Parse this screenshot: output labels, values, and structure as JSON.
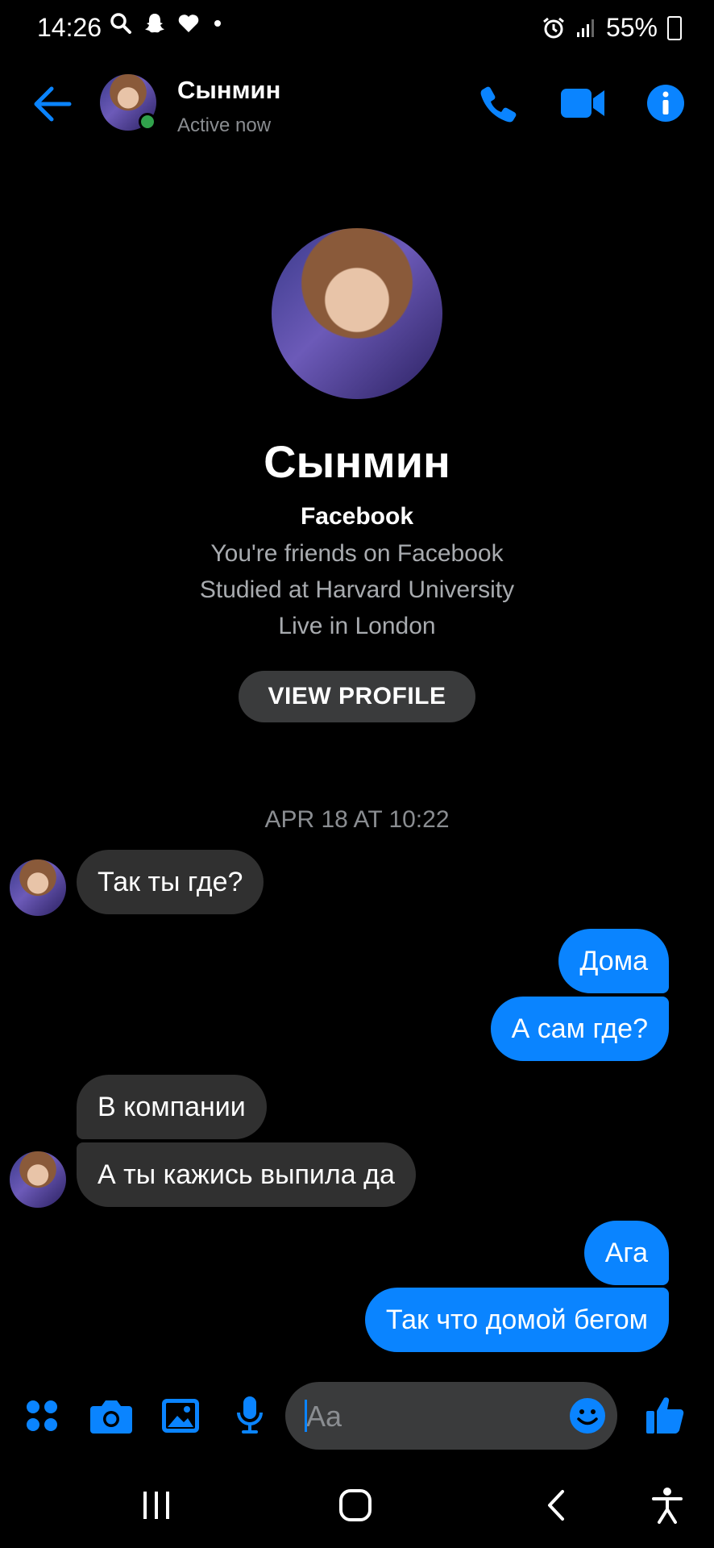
{
  "status_bar": {
    "time": "14:26",
    "battery": "55%"
  },
  "header": {
    "name": "Сынмин",
    "status": "Active now"
  },
  "profile": {
    "name": "Сынмин",
    "source": "Facebook",
    "info": [
      "You're friends on Facebook",
      "Studied at Harvard University",
      "Live in London"
    ],
    "view_profile_label": "VIEW PROFILE"
  },
  "conversation": {
    "date_separator": "APR 18 AT 10:22",
    "messages": [
      {
        "from": "them",
        "text": "Так ты где?"
      },
      {
        "from": "me",
        "text": "Дома"
      },
      {
        "from": "me",
        "text": "А сам где?"
      },
      {
        "from": "them",
        "text": "В компании"
      },
      {
        "from": "them",
        "text": "А ты кажись выпила да"
      },
      {
        "from": "me",
        "text": "Ага"
      },
      {
        "from": "me",
        "text": "Так что домой бегом"
      }
    ]
  },
  "composer": {
    "placeholder": "Aa"
  },
  "colors": {
    "accent": "#0a84ff",
    "incoming_bubble": "#303030",
    "background": "#000000",
    "online": "#31a24c"
  }
}
